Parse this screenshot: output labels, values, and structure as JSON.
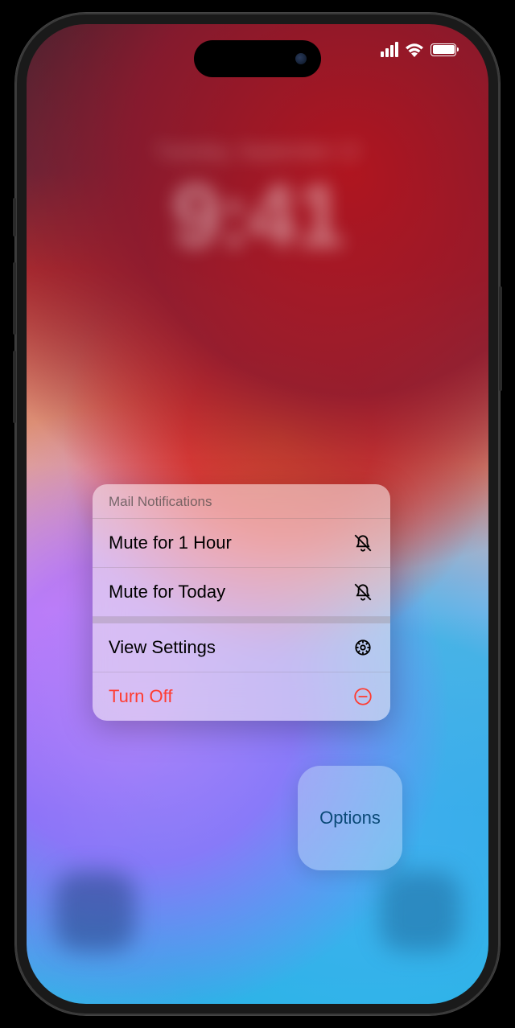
{
  "lock_screen": {
    "date_text": "Tuesday, September 12",
    "time_text": "9:41"
  },
  "status": {
    "cellular_bars": 4,
    "wifi": true,
    "battery_pct": 100
  },
  "menu": {
    "header": "Mail Notifications",
    "mute_hour": "Mute for 1 Hour",
    "mute_today": "Mute for Today",
    "view_settings": "View Settings",
    "turn_off": "Turn Off"
  },
  "options_button": {
    "label": "Options"
  },
  "colors": {
    "destructive": "#ff3b30",
    "options_text": "#0b4a78"
  }
}
